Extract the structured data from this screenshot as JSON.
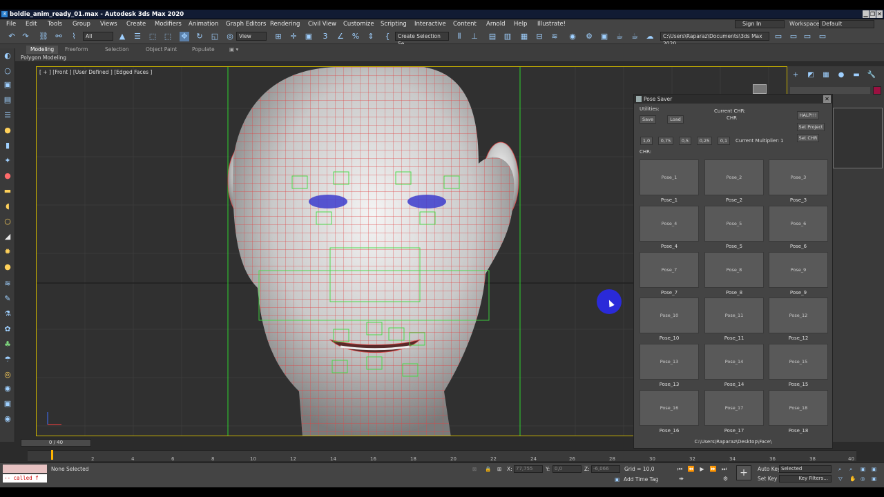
{
  "window": {
    "title": "boldie_anim_ready_01.max - Autodesk 3ds Max 2020",
    "controls": [
      "▁",
      "❐",
      "✕"
    ]
  },
  "menu": {
    "items": [
      "File",
      "Edit",
      "Tools",
      "Group",
      "Views",
      "Create",
      "Modifiers",
      "Animation",
      "Graph Editors",
      "Rendering",
      "Civil View",
      "Customize",
      "Scripting",
      "Interactive",
      "Content",
      "Arnold",
      "Help",
      "Illustrate!"
    ],
    "sign_in": "Sign In",
    "workspaces_label": "Workspaces:",
    "workspace_value": "Default"
  },
  "toolbar": {
    "filter": "All",
    "ref_coord": "View",
    "selection_set": "Create Selection Se",
    "project_path": "C:\\Users\\Raparaz\\Documents\\3ds Max 2020"
  },
  "ribbon": {
    "tabs": [
      "Modeling",
      "Freeform",
      "Selection",
      "Object Paint",
      "Populate"
    ],
    "sub_label": "Polygon Modeling"
  },
  "viewport": {
    "label": "[ + ] [Front ] [User Defined ] [Edged Faces ]",
    "wire_color": "#e04545",
    "grid_color": "#3a3a3a",
    "frame_color": "#c9b200"
  },
  "pose_saver": {
    "title": "Pose Saver",
    "utilities_label": "Utilities:",
    "save_label": "Save",
    "load_label": "Load",
    "current_chr_label": "Current CHR:",
    "current_chr_value": "CHR",
    "halp_label": "HALP!!!",
    "set_project_label": "Set Project",
    "set_chr_label": "Set CHR",
    "multipliers": [
      "1,0",
      "0,75",
      "0,5",
      "0,25",
      "0,1"
    ],
    "current_multiplier_label": "Current Multiplier:",
    "current_multiplier_value": "1",
    "chr_label": "CHR:",
    "poses": [
      "Pose_1",
      "Pose_2",
      "Pose_3",
      "Pose_4",
      "Pose_5",
      "Pose_6",
      "Pose_7",
      "Pose_8",
      "Pose_9",
      "Pose_10",
      "Pose_11",
      "Pose_12",
      "Pose_13",
      "Pose_14",
      "Pose_15",
      "Pose_16",
      "Pose_17",
      "Pose_18"
    ],
    "path": "C:\\Users\\Raparaz\\Desktop\\Face\\"
  },
  "timeline": {
    "slider": "0 / 40",
    "ticks": [
      "2",
      "4",
      "6",
      "8",
      "10",
      "12",
      "14",
      "16",
      "18",
      "20",
      "22",
      "24",
      "26",
      "28",
      "30",
      "32",
      "34",
      "36",
      "38",
      "40"
    ]
  },
  "status": {
    "script_line": "-- called f",
    "selection": "None Selected",
    "x_label": "X:",
    "x_value": "77,755",
    "y_label": "Y:",
    "y_value": "0,0",
    "z_label": "Z:",
    "z_value": "-6,066",
    "grid": "Grid = 10,0",
    "add_time_tag": "Add Time Tag",
    "auto_key": "Auto Key",
    "set_key": "Set Key",
    "selected": "Selected",
    "key_filters": "Key Filters..."
  }
}
